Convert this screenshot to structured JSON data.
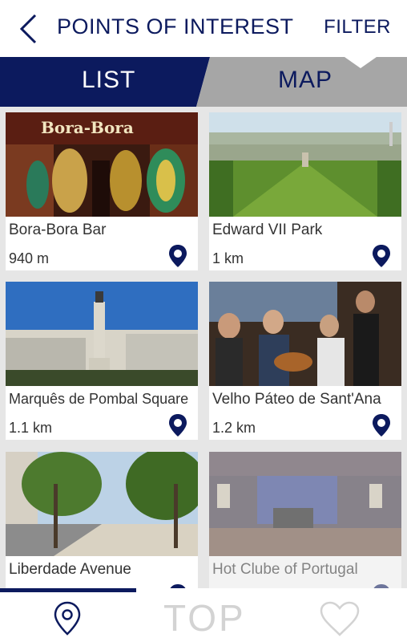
{
  "header": {
    "title": "POINTS OF INTEREST",
    "filter_label": "FILTER"
  },
  "tabs": [
    {
      "label": "LIST",
      "active": true
    },
    {
      "label": "MAP",
      "active": false
    }
  ],
  "colors": {
    "brand": "#0c1a5e",
    "tab_inactive": "#a6a6a6",
    "background": "#e6e6e6"
  },
  "places": [
    {
      "name": "Bora-Bora Bar",
      "distance": "940 m"
    },
    {
      "name": "Edward VII Park",
      "distance": "1 km"
    },
    {
      "name": "Marquês de Pombal Square",
      "distance": "1.1 km"
    },
    {
      "name": "Velho Páteo de Sant'Ana",
      "distance": "1.2 km"
    },
    {
      "name": "Liberdade Avenue",
      "distance": ""
    },
    {
      "name": "Hot Clube of Portugal",
      "distance": ""
    }
  ],
  "photo_sign": "Bora-Bora",
  "bottom_nav": {
    "map_pin": "location-pin-icon",
    "top_label": "TOP",
    "favorites": "heart-icon"
  }
}
